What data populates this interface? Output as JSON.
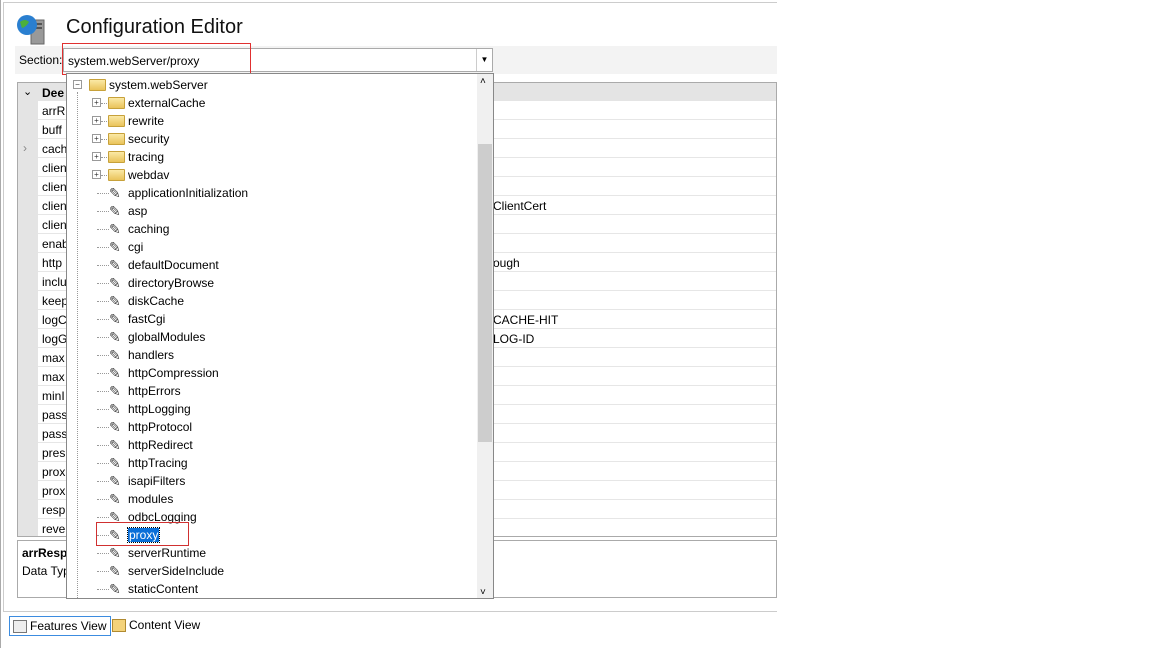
{
  "title": "Configuration Editor",
  "section": {
    "label": "Section:",
    "value": "system.webServer/proxy"
  },
  "grid": {
    "header": "Dee",
    "rows": [
      {
        "name": "arrR",
        "value": ""
      },
      {
        "name": "buff",
        "value": ""
      },
      {
        "name": "cach",
        "value": "",
        "expandable": true
      },
      {
        "name": "clien",
        "value": ""
      },
      {
        "name": "clien",
        "value": ""
      },
      {
        "name": "clien",
        "value": "ClientCert"
      },
      {
        "name": "clien",
        "value": ""
      },
      {
        "name": "enab",
        "value": ""
      },
      {
        "name": "http",
        "value": "ough"
      },
      {
        "name": "inclu",
        "value": ""
      },
      {
        "name": "keep",
        "value": ""
      },
      {
        "name": "logC",
        "value": "CACHE-HIT"
      },
      {
        "name": "logG",
        "value": "LOG-ID"
      },
      {
        "name": "max",
        "value": ""
      },
      {
        "name": "max",
        "value": ""
      },
      {
        "name": "minI",
        "value": ""
      },
      {
        "name": "pass",
        "value": ""
      },
      {
        "name": "pass",
        "value": ""
      },
      {
        "name": "pres",
        "value": ""
      },
      {
        "name": "prox",
        "value": ""
      },
      {
        "name": "prox",
        "value": ""
      },
      {
        "name": "resp",
        "value": ""
      },
      {
        "name": "reve",
        "value": ""
      }
    ]
  },
  "props": {
    "name": "arrResp",
    "datatype": "Data Typ"
  },
  "views": {
    "features": "Features View",
    "content": "Content View"
  },
  "dropdown": {
    "root": "system.webServer",
    "folders": [
      "externalCache",
      "rewrite",
      "security",
      "tracing",
      "webdav"
    ],
    "sections": [
      "applicationInitialization",
      "asp",
      "caching",
      "cgi",
      "defaultDocument",
      "directoryBrowse",
      "diskCache",
      "fastCgi",
      "globalModules",
      "handlers",
      "httpCompression",
      "httpErrors",
      "httpLogging",
      "httpProtocol",
      "httpRedirect",
      "httpTracing",
      "isapiFilters",
      "modules",
      "odbcLogging",
      "proxy",
      "serverRuntime",
      "serverSideInclude",
      "staticContent"
    ],
    "selected": "proxy"
  },
  "colors": {
    "selection": "#0a6fd8",
    "highlight_box": "#e03030"
  }
}
